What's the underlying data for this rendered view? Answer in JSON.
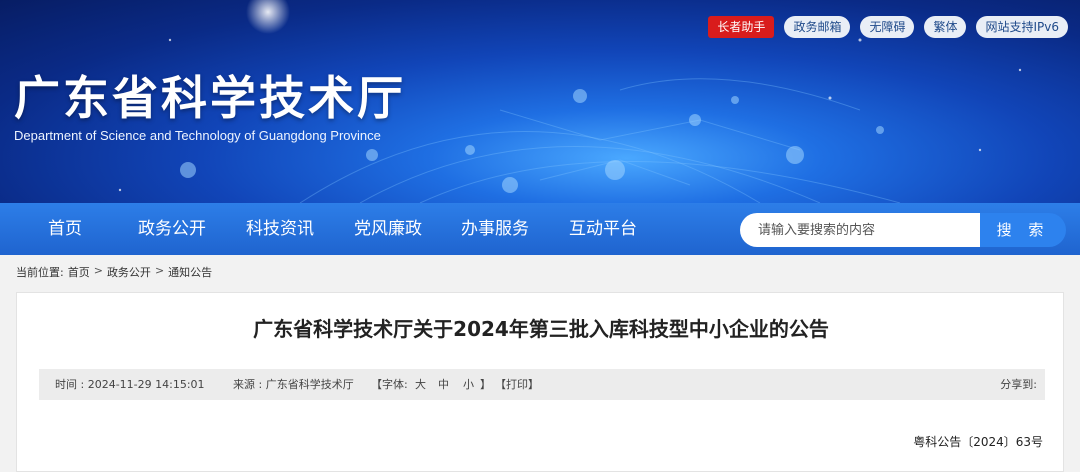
{
  "header": {
    "title": "广东省科学技术厅",
    "subtitle": "Department of Science and Technology of Guangdong Province",
    "top_links": [
      "长者助手",
      "政务邮箱",
      "无障碍",
      "繁体",
      "网站支持IPv6"
    ]
  },
  "nav": {
    "items": [
      "首页",
      "政务公开",
      "科技资讯",
      "党风廉政",
      "办事服务",
      "互动平台"
    ],
    "search_placeholder": "请输入要搜索的内容",
    "search_button": "搜 索"
  },
  "breadcrumb": {
    "prefix": "当前位置:",
    "items": [
      "首页",
      "政务公开",
      "通知公告"
    ],
    "separator": ">"
  },
  "article": {
    "title": "广东省科学技术厅关于2024年第三批入库科技型中小企业的公告",
    "meta": {
      "time": "时间 : 2024-11-29 14:15:01",
      "source": "来源 : 广东省科学技术厅",
      "font_label": "【字体:",
      "font_large": "大",
      "font_medium": "中",
      "font_small": "小",
      "font_close": "】",
      "print": "【打印】",
      "share": "分享到:"
    },
    "doc_number": "粤科公告〔2024〕63号"
  }
}
